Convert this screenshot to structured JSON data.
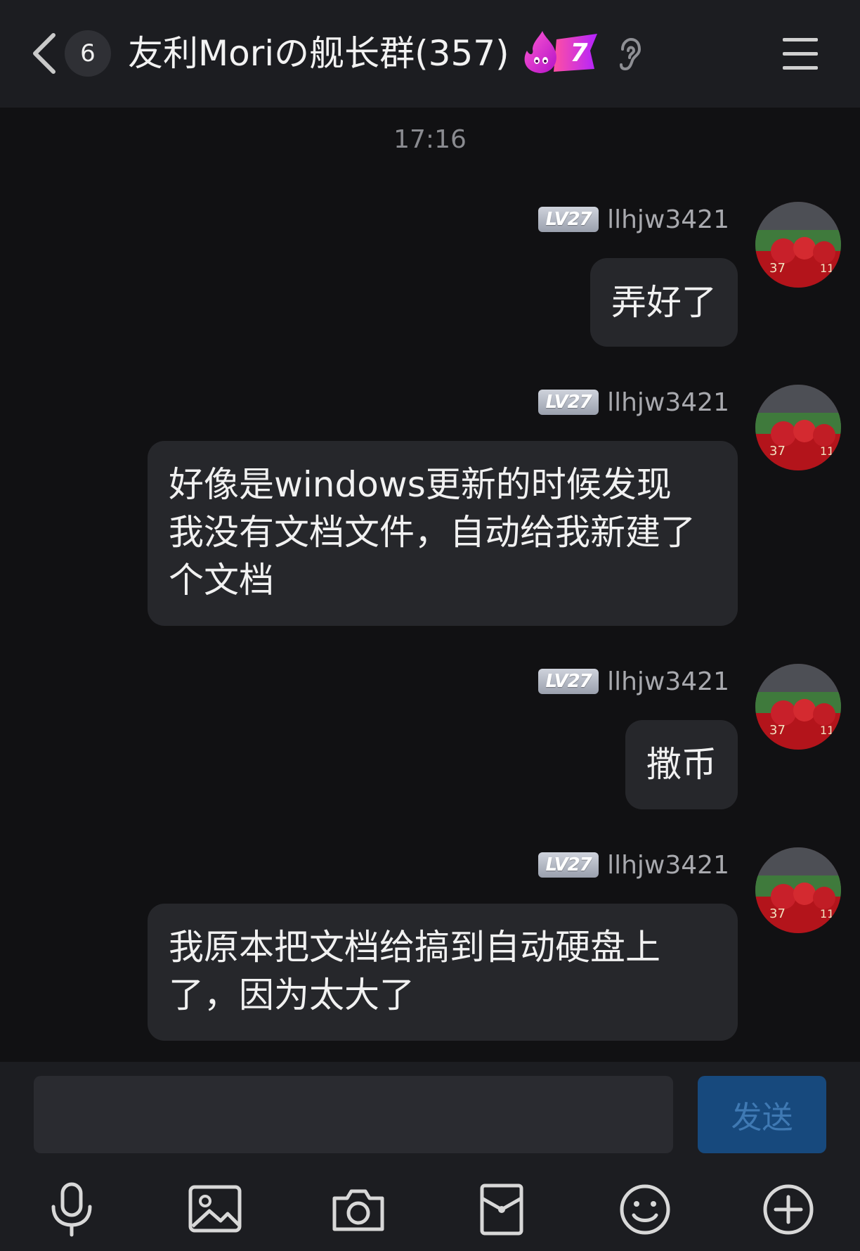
{
  "header": {
    "unread_count": "6",
    "group_title": "友利Moriの舰长群(357)",
    "fire_level": "7"
  },
  "timestamp": "17:16",
  "messages": [
    {
      "level": "LV27",
      "username": "llhjw3421",
      "text": "弄好了"
    },
    {
      "level": "LV27",
      "username": "llhjw3421",
      "text_lines": [
        "好像是windows更新的时候发现",
        "我没有文档文件，自动给我新建了",
        "个文档"
      ]
    },
    {
      "level": "LV27",
      "username": "llhjw3421",
      "text": "撒币"
    },
    {
      "level": "LV27",
      "username": "llhjw3421",
      "text_lines": [
        "我原本把文档给搞到自动硬盘上",
        "了，因为太大了"
      ]
    }
  ],
  "input": {
    "value": "",
    "send_label": "发送"
  },
  "toolbar": {
    "icons": [
      "microphone-icon",
      "image-icon",
      "camera-icon",
      "red-packet-icon",
      "emoji-icon",
      "plus-icon"
    ]
  },
  "colors": {
    "background": "#111113",
    "header": "#1c1d21",
    "bubble": "#26272b",
    "send_button": "#17497d"
  }
}
